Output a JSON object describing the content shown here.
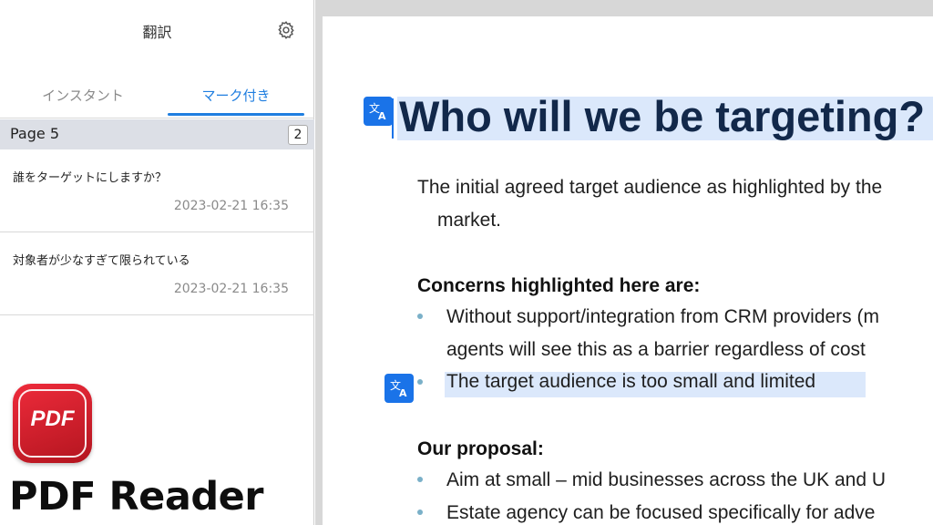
{
  "panel": {
    "title": "翻訳",
    "settings_icon": "gear-icon",
    "tabs": [
      {
        "label": "インスタント",
        "active": false
      },
      {
        "label": "マーク付き",
        "active": true
      }
    ],
    "group": {
      "label": "Page 5",
      "count": "2"
    },
    "entries": [
      {
        "text": "誰をターゲットにしますか？",
        "time": "2023-02-21 16:35"
      },
      {
        "text": "対象者が少なすぎて限られている",
        "time": "2023-02-21 16:35"
      }
    ],
    "accent_color": "#1f7ee0"
  },
  "branding": {
    "logo_text": "PDF",
    "app_name": "PDF Reader",
    "logo_color": "#d91f2b"
  },
  "document": {
    "title": "Who will we be targeting?",
    "paragraph_line1": "The initial agreed target audience as highlighted by the",
    "paragraph_line2": "market.",
    "heading_concerns": "Concerns highlighted here are:",
    "concerns": [
      {
        "line1": "Without support/integration from CRM providers (m",
        "line2": "agents will see this as a barrier regardless of cost"
      },
      {
        "line1": "The target audience is too small and limited"
      }
    ],
    "heading_proposal": "Our proposal:",
    "proposals": [
      "Aim at small – mid businesses across the UK and U",
      "Estate agency can be focused specifically for adve"
    ],
    "translate_icon": "translate-icon",
    "highlight_color": "#dbe8fb"
  }
}
